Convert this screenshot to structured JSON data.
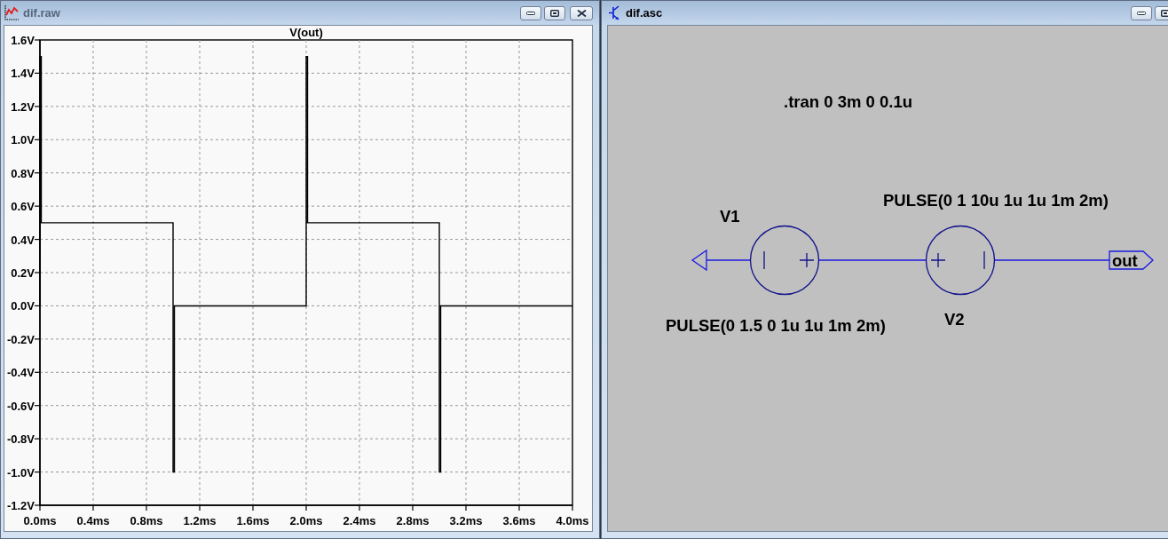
{
  "windows": [
    {
      "kind": "waveform",
      "title": "dif.raw",
      "active": false,
      "plot": {
        "chart_data": {
          "type": "line",
          "title": "V(out)",
          "grid": true,
          "x": [
            0,
            0.001,
            0.01,
            0.01,
            1,
            1,
            1.01,
            1.01,
            2,
            2,
            2.01,
            2.01,
            3,
            3,
            3.01,
            3.01,
            4
          ],
          "values": [
            0,
            1.5,
            1.5,
            0.5,
            0.5,
            -1,
            -1,
            0,
            0,
            1.5,
            1.5,
            0.5,
            0.5,
            -1,
            -1,
            0,
            0
          ],
          "xlim": [
            0,
            4
          ],
          "ylim": [
            -1.2,
            1.6
          ],
          "xticks": [
            {
              "value": 0,
              "label": "0.0ms"
            },
            {
              "value": 0.4,
              "label": "0.4ms"
            },
            {
              "value": 0.8,
              "label": "0.8ms"
            },
            {
              "value": 1.2,
              "label": "1.2ms"
            },
            {
              "value": 1.6,
              "label": "1.6ms"
            },
            {
              "value": 2,
              "label": "2.0ms"
            },
            {
              "value": 2.4,
              "label": "2.4ms"
            },
            {
              "value": 2.8,
              "label": "2.8ms"
            },
            {
              "value": 3.2,
              "label": "3.2ms"
            },
            {
              "value": 3.6,
              "label": "3.6ms"
            },
            {
              "value": 4,
              "label": "4.0ms"
            }
          ],
          "yticks": [
            {
              "value": 1.6,
              "label": "1.6V"
            },
            {
              "value": 1.4,
              "label": "1.4V"
            },
            {
              "value": 1.2,
              "label": "1.2V"
            },
            {
              "value": 1,
              "label": "1.0V"
            },
            {
              "value": 0.8,
              "label": "0.8V"
            },
            {
              "value": 0.6,
              "label": "0.6V"
            },
            {
              "value": 0.4,
              "label": "0.4V"
            },
            {
              "value": 0.2,
              "label": "0.2V"
            },
            {
              "value": 0,
              "label": "0.0V"
            },
            {
              "value": -0.2,
              "label": "-0.2V"
            },
            {
              "value": -0.4,
              "label": "-0.4V"
            },
            {
              "value": -0.6,
              "label": "-0.6V"
            },
            {
              "value": -0.8,
              "label": "-0.8V"
            },
            {
              "value": -1,
              "label": "-1.0V"
            },
            {
              "value": -1.2,
              "label": "-1.2V"
            }
          ]
        }
      }
    },
    {
      "kind": "schematic",
      "title": "dif.asc",
      "active": true,
      "schematic": {
        "directive": ".tran 0 3m 0 0.1u",
        "sources": [
          {
            "name": "V1",
            "value": "PULSE(0 1.5 0 1u 1u 1m 2m)"
          },
          {
            "name": "V2",
            "value": "PULSE(0 1 10u 1u 1u 1m 2m)"
          }
        ],
        "net_label": "out"
      }
    }
  ]
}
